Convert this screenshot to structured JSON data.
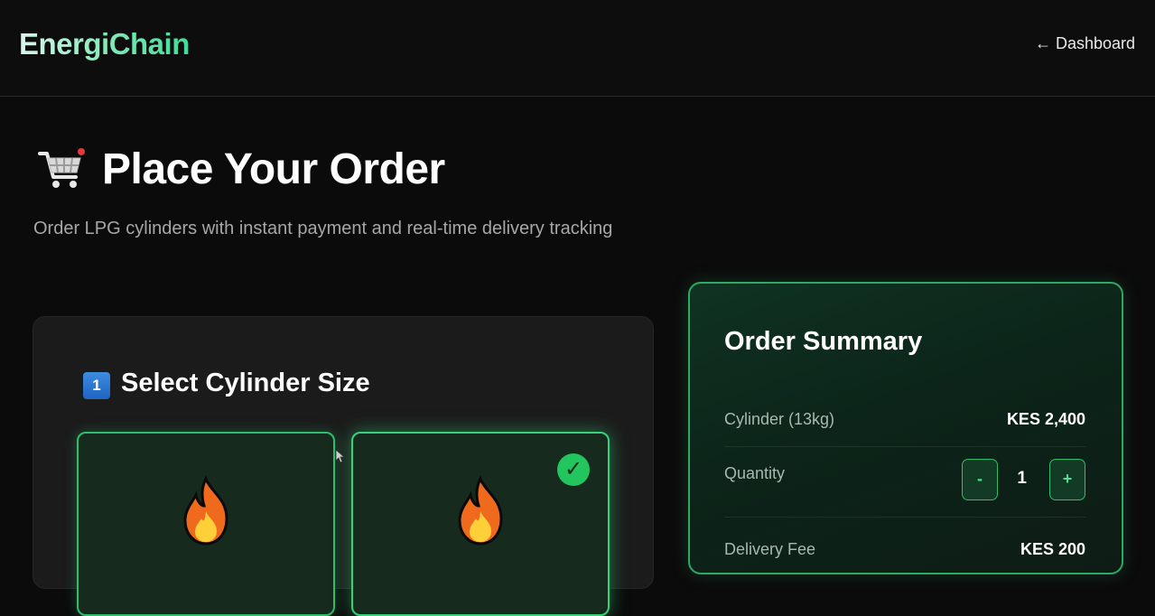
{
  "header": {
    "brand": "EnergiChain",
    "back_link": "← Dashboard"
  },
  "page": {
    "icon": "shopping-cart-icon",
    "title": "Place Your Order",
    "subtitle": "Order LPG cylinders with instant payment and real-time delivery tracking"
  },
  "select_panel": {
    "step_number": "1",
    "title": "Select Cylinder Size",
    "cards": [
      {
        "icon": "flame-icon",
        "selected": false
      },
      {
        "icon": "flame-icon",
        "selected": true,
        "check_icon": "✓"
      }
    ]
  },
  "summary": {
    "title": "Order Summary",
    "cylinder_label": "Cylinder (13kg)",
    "cylinder_value": "KES 2,400",
    "quantity_label": "Quantity",
    "quantity_minus": "-",
    "quantity_value": "1",
    "quantity_plus": "+",
    "delivery_label": "Delivery Fee",
    "delivery_value": "KES 200"
  },
  "colors": {
    "accent": "#2fbf6b",
    "background": "#0b0b0b",
    "panel": "#1b1b1b"
  }
}
